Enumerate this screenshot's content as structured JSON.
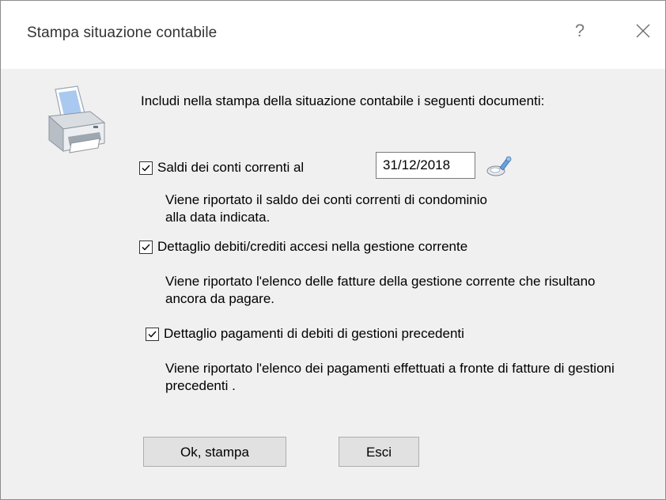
{
  "window": {
    "title": "Stampa situazione contabile",
    "help_glyph": "?",
    "close_icon": "close-icon"
  },
  "intro": "Includi nella stampa della situazione contabile i seguenti documenti:",
  "options": [
    {
      "label": "Saldi dei conti correnti al",
      "checked": true,
      "description": "Viene riportato il saldo dei conti correnti di condominio alla data indicata."
    },
    {
      "label": "Dettaglio debiti/crediti accesi nella gestione corrente",
      "checked": true,
      "description": "Viene riportato l'elenco delle fatture della gestione corrente che risultano ancora da pagare."
    },
    {
      "label": "Dettaglio pagamenti di debiti di gestioni precedenti",
      "checked": true,
      "description": "Viene riportato l'elenco dei pagamenti effettuati a fronte di fatture di gestioni precedenti ."
    }
  ],
  "date": {
    "value": "31/12/2018",
    "picker_icon": "calendar-lookup-icon"
  },
  "buttons": {
    "ok": "Ok, stampa",
    "exit": "Esci"
  },
  "icons": {
    "printer": "printer-icon"
  }
}
